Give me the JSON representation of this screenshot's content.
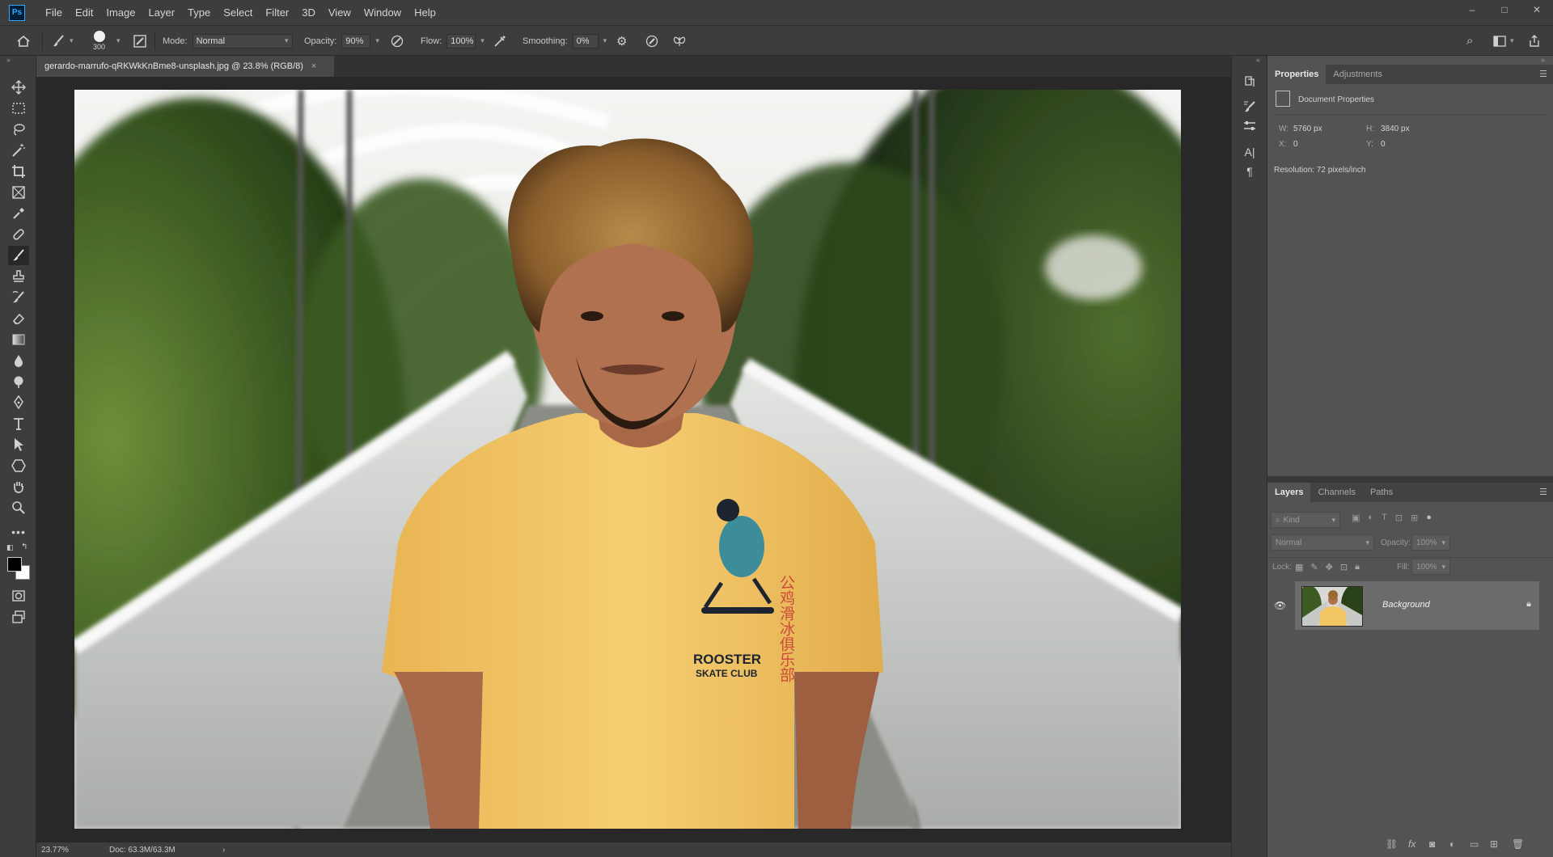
{
  "app": {
    "logo": "Ps"
  },
  "menu": [
    "File",
    "Edit",
    "Image",
    "Layer",
    "Type",
    "Select",
    "Filter",
    "3D",
    "View",
    "Window",
    "Help"
  ],
  "window_controls": {
    "minimize": "–",
    "maximize": "□",
    "close": "✕"
  },
  "options": {
    "brush_size": "300",
    "mode_label": "Mode:",
    "mode_value": "Normal",
    "opacity_label": "Opacity:",
    "opacity_value": "90%",
    "flow_label": "Flow:",
    "flow_value": "100%",
    "smoothing_label": "Smoothing:",
    "smoothing_value": "0%"
  },
  "document": {
    "tab_title": "gerardo-marrufo-qRKWkKnBme8-unsplash.jpg @ 23.8% (RGB/8)",
    "close_glyph": "×"
  },
  "status": {
    "zoom": "23.77%",
    "doc": "Doc: 63.3M/63.3M",
    "arrow": "›"
  },
  "shirt": {
    "brand_line1": "ROOSTER",
    "brand_line2": "SKATE CLUB",
    "chinese": "公鸡滑冰俱乐部"
  },
  "properties_panel": {
    "tabs": [
      "Properties",
      "Adjustments"
    ],
    "section": "Document Properties",
    "w_label": "W:",
    "w_value": "5760 px",
    "h_label": "H:",
    "h_value": "3840 px",
    "x_label": "X:",
    "x_value": "0",
    "y_label": "Y:",
    "y_value": "0",
    "resolution": "Resolution: 72 pixels/inch"
  },
  "layers_panel": {
    "tabs": [
      "Layers",
      "Channels",
      "Paths"
    ],
    "filter_placeholder": "Kind",
    "blend_mode": "Normal",
    "opacity_label": "Opacity:",
    "opacity_value": "100%",
    "lock_label": "Lock:",
    "fill_label": "Fill:",
    "fill_value": "100%",
    "layers": [
      {
        "name": "Background",
        "visible": true,
        "locked": true
      }
    ]
  },
  "colors": {
    "accent": "#31a8ff",
    "bg_dark": "#282828",
    "panel": "#535353",
    "chrome": "#3d3d3d",
    "shirt": "#f2c565"
  }
}
